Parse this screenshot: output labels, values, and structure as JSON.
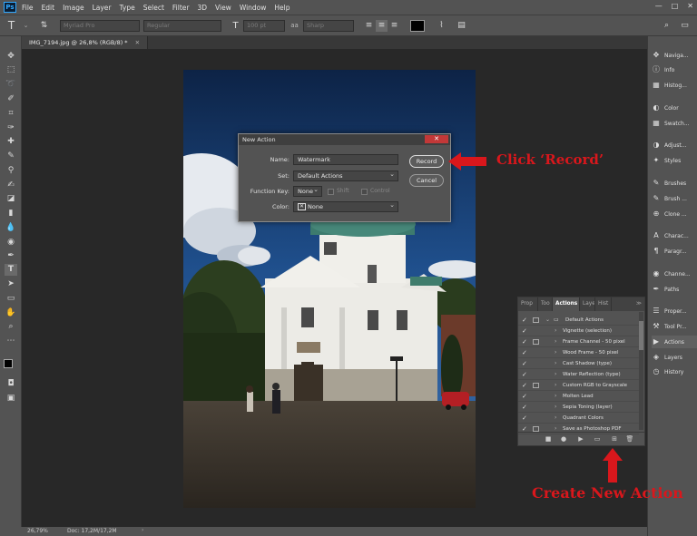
{
  "menubar": {
    "logo": "Ps",
    "items": [
      "File",
      "Edit",
      "Image",
      "Layer",
      "Type",
      "Select",
      "Filter",
      "3D",
      "View",
      "Window",
      "Help"
    ],
    "window_controls": [
      "—",
      "□",
      "✕"
    ]
  },
  "options": {
    "tool_glyph": "T",
    "font_family": "Myriad Pro",
    "font_style": "Regular",
    "size_glyph": "T",
    "font_size": "100 pt",
    "aa_prefix": "aa",
    "anti_alias": "Sharp"
  },
  "document": {
    "tab_title": "IMG_7194.jpg @ 26,8% (RGB/8) *",
    "tab_close": "✕",
    "zoom": "26,79%",
    "doc_info": "Doc: 17,2M/17,2M"
  },
  "right_panels": [
    {
      "label": "Naviga...",
      "icon": "navigator-icon",
      "glyph": "✥"
    },
    {
      "label": "Info",
      "icon": "info-icon",
      "glyph": "ⓘ"
    },
    {
      "label": "Histog...",
      "icon": "histogram-icon",
      "glyph": "▦"
    },
    {
      "label": "Color",
      "icon": "color-icon",
      "glyph": "◐"
    },
    {
      "label": "Swatch...",
      "icon": "swatches-icon",
      "glyph": "▦"
    },
    {
      "label": "Adjust...",
      "icon": "adjustments-icon",
      "glyph": "◑"
    },
    {
      "label": "Styles",
      "icon": "styles-icon",
      "glyph": "✦"
    },
    {
      "label": "Brushes",
      "icon": "brushes-icon",
      "glyph": "✎"
    },
    {
      "label": "Brush ...",
      "icon": "brush-settings-icon",
      "glyph": "✎"
    },
    {
      "label": "Clone ...",
      "icon": "clone-source-icon",
      "glyph": "⊕"
    },
    {
      "label": "Charac...",
      "icon": "character-icon",
      "glyph": "A"
    },
    {
      "label": "Paragr...",
      "icon": "paragraph-icon",
      "glyph": "¶"
    },
    {
      "label": "Channe...",
      "icon": "channels-icon",
      "glyph": "◉"
    },
    {
      "label": "Paths",
      "icon": "paths-icon",
      "glyph": "✒"
    },
    {
      "label": "Proper...",
      "icon": "properties-icon",
      "glyph": "☰"
    },
    {
      "label": "Tool Pr...",
      "icon": "tool-presets-icon",
      "glyph": "⚒"
    },
    {
      "label": "Actions",
      "icon": "actions-icon",
      "glyph": "▶"
    },
    {
      "label": "Layers",
      "icon": "layers-icon",
      "glyph": "◈"
    },
    {
      "label": "History",
      "icon": "history-icon",
      "glyph": "◷"
    }
  ],
  "dialog": {
    "title": "New Action",
    "close": "✕",
    "name_label": "Name:",
    "name_value": "Watermark",
    "set_label": "Set:",
    "set_value": "Default Actions",
    "fkey_label": "Function Key:",
    "fkey_value": "None",
    "shift_label": "Shift",
    "control_label": "Control",
    "color_label": "Color:",
    "color_mark": "✕",
    "color_value": "None",
    "record_label": "Record",
    "cancel_label": "Cancel"
  },
  "actions_panel": {
    "tabs": [
      "Prop",
      "Too",
      "Actions",
      "Laye",
      "Hist"
    ],
    "menu_glyph": "≫",
    "check": "✓",
    "expand": "›",
    "folder": "Default Actions",
    "items": [
      "Vignette (selection)",
      "Frame Channel - 50 pixel",
      "Wood Frame - 50 pixel",
      "Cast Shadow (type)",
      "Water Reflection (type)",
      "Custom RGB to Grayscale",
      "Molten Lead",
      "Sepia Toning (layer)",
      "Quadrant Colors",
      "Save as Photoshop PDF"
    ],
    "footer_glyphs": [
      "■",
      "●",
      "▶",
      "▭",
      "⊞",
      "🗑"
    ]
  },
  "annotations": {
    "record_callout": "Click ‘Record’",
    "create_callout": "Create New Action"
  },
  "colors": {
    "annotation_red": "#d9171c",
    "accent_blue": "#31a8ff"
  }
}
